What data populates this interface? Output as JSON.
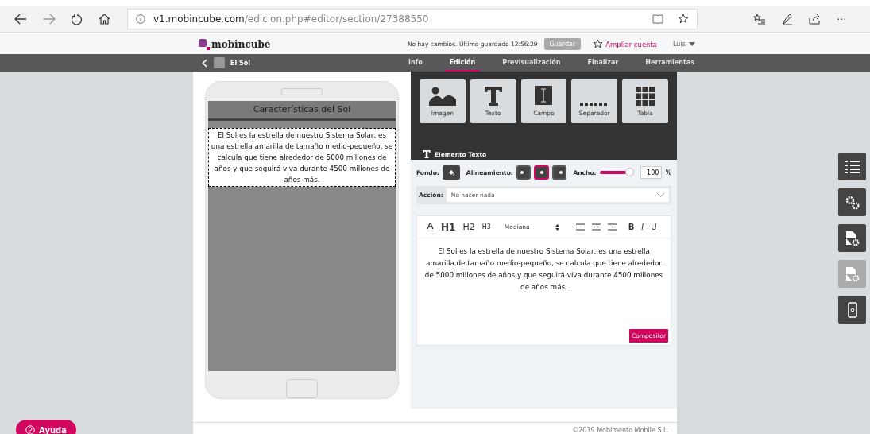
{
  "browser": {
    "url_host": "v1.mobincube.com",
    "url_path": "/edicion.php#editor/section/27388550",
    "more": "···"
  },
  "header": {
    "logo": "mobincube",
    "status": "No hay cambios. Último guardado 12:56:29",
    "save": "Guardar",
    "upgrade": "Ampliar cuenta",
    "user": "Luis"
  },
  "nav": {
    "section": "El Sol",
    "tabs": [
      {
        "label": "Info",
        "selected": false
      },
      {
        "label": "Edición",
        "selected": true
      },
      {
        "label": "Previsualización",
        "selected": false
      },
      {
        "label": "Finalizar",
        "selected": false
      },
      {
        "label": "Herramientas",
        "selected": false
      }
    ]
  },
  "phone": {
    "title": "Características del Sol",
    "text": "El Sol es la estrella de nuestro Sistema Solar, es una estrella amarilla de tamaño medio-pequeño, se calcula que tiene alrededor de 5000 millones de años y que seguirá viva durante 4500 millones de años más."
  },
  "widgets": [
    {
      "kind": "image",
      "label": "Imagen"
    },
    {
      "kind": "text",
      "label": "Texto"
    },
    {
      "kind": "field",
      "label": "Campo"
    },
    {
      "kind": "separator",
      "label": "Separador"
    },
    {
      "kind": "table",
      "label": "Tabla"
    }
  ],
  "element_title": "Elemento Texto",
  "properties": {
    "background_label": "Fondo:",
    "alignment_label": "Alineamiento:",
    "alignments": [
      {
        "kind": "left",
        "selected": false
      },
      {
        "kind": "center",
        "selected": true
      },
      {
        "kind": "right",
        "selected": false
      }
    ],
    "width_label": "Ancho:",
    "width": {
      "level": 0.9,
      "value": "100",
      "unit": "%"
    },
    "action_label": "Acción:",
    "action_value": "No hacer nada"
  },
  "editor": {
    "toolbar": [
      {
        "kind": "color"
      },
      {
        "kind": "h1",
        "label": "H1"
      },
      {
        "kind": "h2",
        "label": "H2"
      },
      {
        "kind": "h3",
        "label": "H3"
      },
      {
        "kind": "select",
        "label": "Mediana"
      },
      {
        "kind": "align-left"
      },
      {
        "kind": "align-center"
      },
      {
        "kind": "align-right"
      },
      {
        "kind": "bold",
        "label": "B"
      },
      {
        "kind": "italic",
        "label": "I"
      },
      {
        "kind": "underline",
        "label": "U"
      }
    ],
    "text": "El Sol es la estrella de nuestro Sistema Solar, es una estrella amarilla de tamaño medio-pequeño, se calcula que tiene alrededor de 5000 millones de años y que seguirá viva durante 4500 millones de años más.",
    "composer": "Compositor"
  },
  "side_tools": [
    {
      "kind": "list",
      "disabled": false
    },
    {
      "kind": "gears",
      "disabled": false
    },
    {
      "kind": "page-gear",
      "disabled": false
    },
    {
      "kind": "page-gear",
      "disabled": true
    },
    {
      "kind": "phone",
      "disabled": false
    }
  ],
  "help": "Ayuda",
  "footer": "©2019 Mobimento Mobile S.L."
}
